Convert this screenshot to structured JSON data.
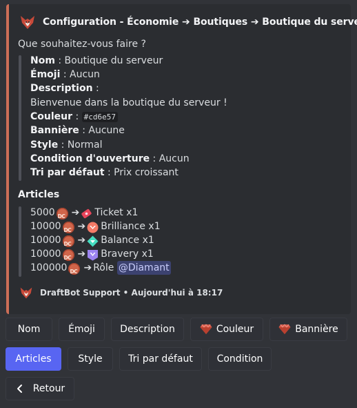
{
  "embed": {
    "accent_color": "#cd6e57",
    "title": "Configuration - Économie ➔ Boutiques ➔ Boutique du serveur",
    "prompt": "Que souhaitez-vous faire ?",
    "fields": {
      "nom_label": "Nom",
      "nom_value": " : Boutique du serveur",
      "emoji_label": "Émoji",
      "emoji_value": " : Aucun",
      "desc_label": "Description",
      "desc_sep": " :",
      "desc_value": "Bienvenue dans la boutique du serveur !",
      "couleur_label": "Couleur",
      "couleur_sep": " : ",
      "couleur_value": "#cd6e57",
      "banniere_label": "Bannière",
      "banniere_value": " : Aucune",
      "style_label": "Style",
      "style_value": " : Normal",
      "condition_label": "Condition d'ouverture",
      "condition_value": " : Aucun",
      "tri_label": "Tri par défaut",
      "tri_value": " : Prix croissant"
    },
    "articles_title": "Articles",
    "articles": [
      {
        "price": "5000",
        "arrow": "➔",
        "name": "Ticket x1",
        "icon": "ticket-icon",
        "color": "#e8455a"
      },
      {
        "price": "10000",
        "arrow": "➔",
        "name": "Brilliance x1",
        "icon": "brilliance-icon",
        "color": "#f47b67"
      },
      {
        "price": "10000",
        "arrow": "➔",
        "name": "Balance x1",
        "icon": "balance-icon",
        "color": "#45ddc0"
      },
      {
        "price": "10000",
        "arrow": "➔",
        "name": "Bravery x1",
        "icon": "bravery-icon",
        "color": "#9c84ef"
      },
      {
        "price": "100000",
        "arrow": "➔",
        "name": "Rôle ",
        "mention": "@Diamant",
        "icon": "role-icon"
      }
    ],
    "footer": "DraftBot Support • Aujourd'hui à 18:17"
  },
  "buttons_row1": [
    "Nom",
    "Émoji",
    "Description",
    "Couleur",
    "Bannière"
  ],
  "buttons_row2": [
    "Articles",
    "Style",
    "Tri par défaut",
    "Condition"
  ],
  "buttons_row3": [
    "Retour"
  ]
}
